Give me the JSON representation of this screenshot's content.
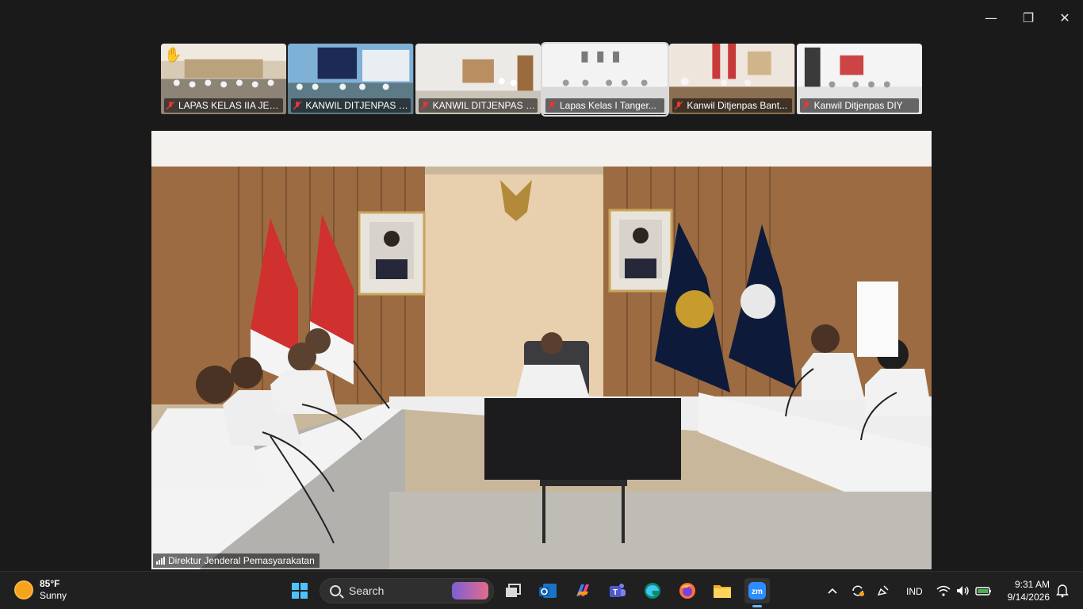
{
  "window": {
    "minimize_icon": "minimize-icon",
    "maximize_icon": "restore-icon",
    "close_icon": "close-icon"
  },
  "participants": [
    {
      "name": "LAPAS KELAS IIA JEM...",
      "muted": true,
      "hand_raised": true
    },
    {
      "name": "KANWIL DITJENPAS S...",
      "muted": true,
      "hand_raised": false
    },
    {
      "name": "KANWIL DITJENPAS L...",
      "muted": true,
      "hand_raised": false
    },
    {
      "name": "Lapas Kelas I Tanger...",
      "muted": true,
      "hand_raised": false
    },
    {
      "name": "Kanwil Ditjenpas Bant...",
      "muted": true,
      "hand_raised": false
    },
    {
      "name": "Kanwil Ditjenpas DIY",
      "muted": true,
      "hand_raised": false
    }
  ],
  "main_video": {
    "speaker_name": "Direktur Jenderal Pemasyarakatan"
  },
  "taskbar": {
    "weather": {
      "temp": "85°F",
      "condition": "Sunny"
    },
    "search_label": "Search",
    "apps": [
      "windows-start-icon",
      "task-view-icon",
      "outlook-icon",
      "copilot-icon",
      "teams-icon",
      "edge-icon",
      "firefox-icon",
      "file-explorer-icon",
      "zoom-icon"
    ],
    "tray": {
      "language": "IND",
      "time": "9:31 AM",
      "date": "9/14/2026"
    }
  },
  "colors": {
    "background": "#1a1a1a",
    "taskbar": "#202020",
    "accent": "#6cb6ff"
  }
}
